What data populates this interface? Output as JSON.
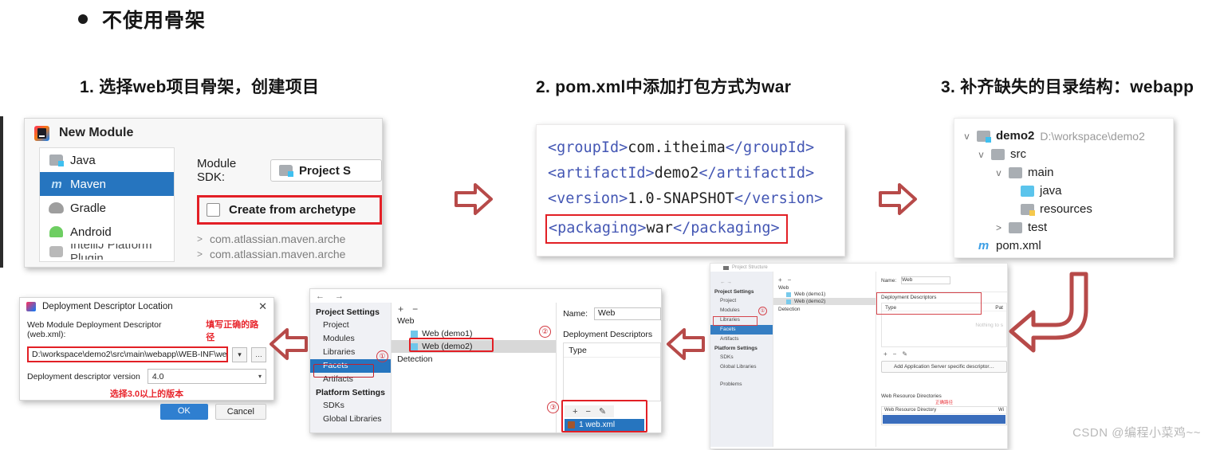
{
  "slide": {
    "bullet": "不使用骨架",
    "steps": [
      "1. 选择web项目骨架，创建项目",
      "2. pom.xml中添加打包方式为war",
      "3. 补齐缺失的目录结构：webapp"
    ],
    "watermark": "CSDN @编程小菜鸡~~"
  },
  "new_module_dialog": {
    "title": "New Module",
    "list": [
      {
        "label": "Java",
        "icon": "folder-icon"
      },
      {
        "label": "Maven",
        "icon": "maven-icon"
      },
      {
        "label": "Gradle",
        "icon": "gradle-icon"
      },
      {
        "label": "Android",
        "icon": "android-icon"
      },
      {
        "label": "IntelliJ Platform Plugin",
        "icon": "plugin-icon"
      }
    ],
    "selected": "Maven",
    "sdk_label": "Module SDK:",
    "sdk_value": "Project S",
    "archetype_label": "Create from archetype",
    "archetype_checked": false,
    "archetype_list": [
      "com.atlassian.maven.arche",
      "com.atlassian.maven.arche"
    ],
    "highlight_color": "#e21f25"
  },
  "pom_code": {
    "lines": [
      {
        "open": "<groupId>",
        "value": "com.itheima",
        "close": "</groupId>",
        "highlight": false
      },
      {
        "open": "<artifactId>",
        "value": "demo2",
        "close": "</artifactId>",
        "highlight": false
      },
      {
        "open": "<version>",
        "value": "1.0-SNAPSHOT",
        "close": "</version>",
        "highlight": false
      },
      {
        "open": "<packaging>",
        "value": "war",
        "close": "</packaging>",
        "highlight": true
      }
    ],
    "tag_color": "#4457b4"
  },
  "project_tree": {
    "rows": [
      {
        "name": "demo2",
        "path": "D:\\workspace\\demo2",
        "twisty": "v",
        "indent": 0,
        "icon": "folder-module-icon",
        "bold": true
      },
      {
        "name": "src",
        "path": "",
        "twisty": "v",
        "indent": 1,
        "icon": "folder-icon",
        "bold": false
      },
      {
        "name": "main",
        "path": "",
        "twisty": "v",
        "indent": 2,
        "icon": "folder-icon",
        "bold": false
      },
      {
        "name": "java",
        "path": "",
        "twisty": "",
        "indent": 3,
        "icon": "folder-source-icon",
        "bold": false
      },
      {
        "name": "resources",
        "path": "",
        "twisty": "",
        "indent": 3,
        "icon": "folder-resources-icon",
        "bold": false
      },
      {
        "name": "test",
        "path": "",
        "twisty": ">",
        "indent": 2,
        "icon": "folder-icon",
        "bold": false
      },
      {
        "name": "pom.xml",
        "path": "",
        "twisty": "",
        "indent": 1,
        "icon": "maven-icon",
        "bold": false
      }
    ]
  },
  "deploy_dialog": {
    "title": "Deployment Descriptor Location",
    "close": "✕",
    "descriptor_label": "Web Module Deployment Descriptor (web.xml):",
    "note_path": "填写正确的路径",
    "path_value": "D:\\workspace\\demo2\\src\\main\\webapp\\WEB-INF\\web.xml",
    "dropdown_caret": "▾",
    "browse_btn": "…",
    "version_label": "Deployment descriptor version",
    "version_value": "4.0",
    "note_version": "选择3.0以上的版本",
    "ok": "OK",
    "cancel": "Cancel"
  },
  "project_structure": {
    "nav_back": "←",
    "nav_forward": "→",
    "sections": [
      {
        "header": "Project Settings",
        "items": [
          "Project",
          "Modules",
          "Libraries",
          "Facets",
          "Artifacts"
        ]
      },
      {
        "header": "Platform Settings",
        "items": [
          "SDKs",
          "Global Libraries"
        ]
      }
    ],
    "selected_item": "Facets",
    "toolbar": {
      "add": "+",
      "remove": "−",
      "edit": "✎"
    },
    "facet_root": "Web",
    "facets": [
      "Web (demo1)",
      "Web (demo2)"
    ],
    "facet_selected": "Web (demo2)",
    "detection": "Detection",
    "name_label": "Name:",
    "name_value": "Web",
    "descriptors_header": "Deployment Descriptors",
    "type_column": "Type",
    "webxml_item": "1  web.xml",
    "markers": [
      "①",
      "②",
      "③"
    ]
  },
  "project_structure_small": {
    "window_title": "Project Structure",
    "sections": [
      {
        "header": "Project Settings",
        "items": [
          "Project",
          "Modules",
          "Libraries",
          "Facets",
          "Artifacts"
        ]
      },
      {
        "header": "Platform Settings",
        "items": [
          "SDKs",
          "Global Libraries"
        ]
      },
      {
        "header": "",
        "items": [
          "Problems"
        ]
      }
    ],
    "selected_item": "Facets",
    "facet_root": "Web",
    "facets": [
      "Web (demo1)",
      "Web (demo2)"
    ],
    "facet_selected": "Web (demo2)",
    "detection": "Detection",
    "name_label": "Name:",
    "name_value": "Web",
    "descriptors_header": "Deployment Descriptors",
    "type_column": "Type",
    "path_column": "Pat",
    "nothing_text": "Nothing to s",
    "add_descriptor_btn": "Add Application Server specific descriptor…",
    "web_res_header": "Web Resource Directories",
    "web_res_column": "Web Resource Directory",
    "web_res_col2": "Wi",
    "marker": "①"
  },
  "arrows": {
    "right1": "right-arrow",
    "right2": "right-arrow",
    "left1": "left-arrow",
    "left2": "left-arrow",
    "bent": "bent-left-arrow",
    "color": "#b74a49"
  }
}
